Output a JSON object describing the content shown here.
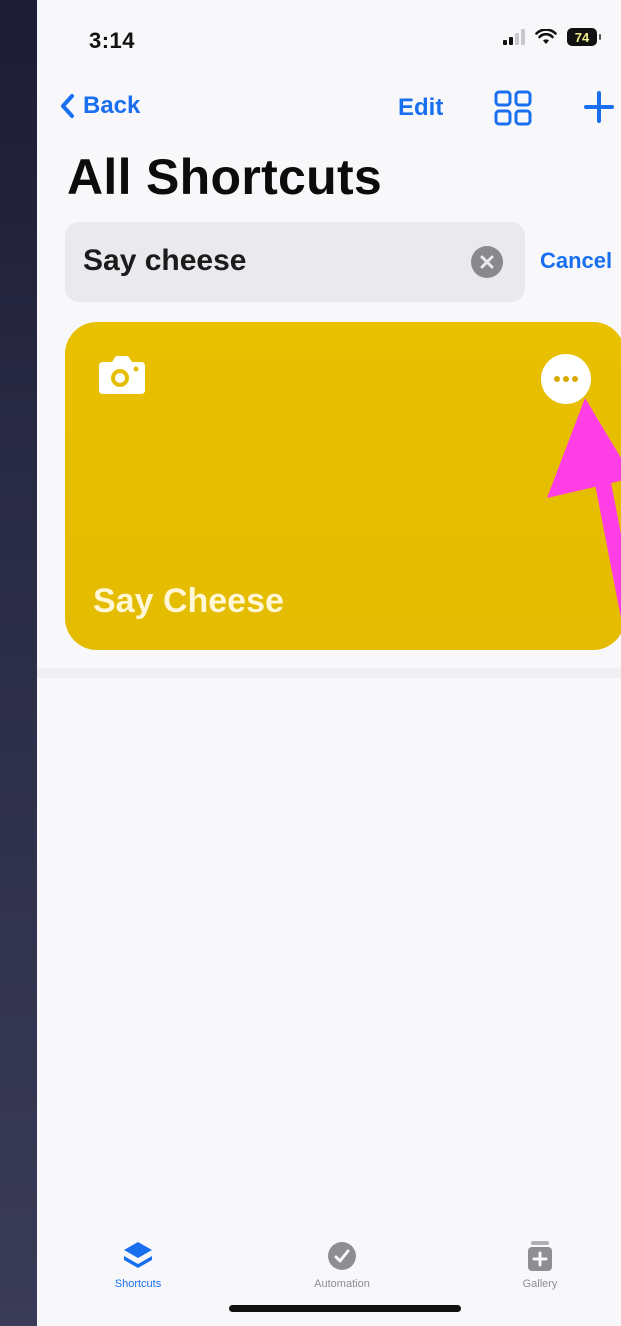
{
  "status": {
    "time": "3:14",
    "battery": "74"
  },
  "nav": {
    "back_label": "Back",
    "edit_label": "Edit"
  },
  "page": {
    "title": "All Shortcuts"
  },
  "search": {
    "value": "Say cheese",
    "cancel_label": "Cancel"
  },
  "shortcut": {
    "name": "Say Cheese",
    "icon": "camera-icon",
    "color": "#e6be00"
  },
  "tabs": [
    {
      "label": "Shortcuts",
      "icon": "shortcuts-stack-icon",
      "active": true
    },
    {
      "label": "Automation",
      "icon": "automation-clock-icon",
      "active": false
    },
    {
      "label": "Gallery",
      "icon": "gallery-icon",
      "active": false
    }
  ],
  "annotation": {
    "arrow_color": "#ff3ee6"
  }
}
